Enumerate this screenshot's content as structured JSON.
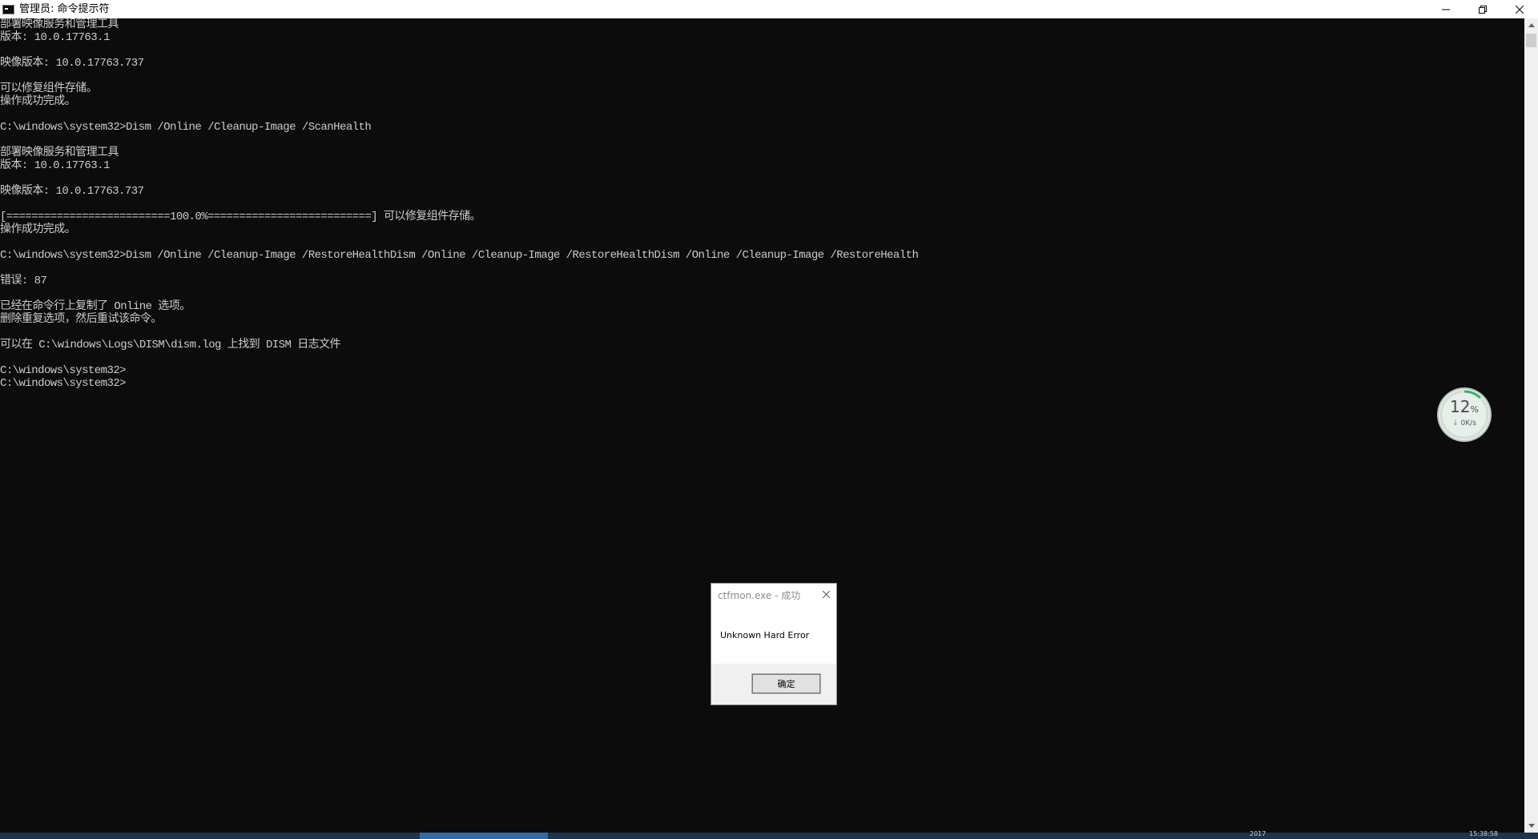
{
  "window": {
    "title": "管理员: 命令提示符",
    "icon": "cmd-icon",
    "controls": {
      "minimize": "minimize-icon",
      "restore": "restore-icon",
      "close": "close-icon"
    }
  },
  "console": {
    "lines": [
      "部署映像服务和管理工具",
      "版本: 10.0.17763.1",
      "",
      "映像版本: 10.0.17763.737",
      "",
      "可以修复组件存储。",
      "操作成功完成。",
      "",
      "C:\\windows\\system32>Dism /Online /Cleanup-Image /ScanHealth",
      "",
      "部署映像服务和管理工具",
      "版本: 10.0.17763.1",
      "",
      "映像版本: 10.0.17763.737",
      "",
      "[==========================100.0%==========================] 可以修复组件存储。",
      "操作成功完成。",
      "",
      "C:\\windows\\system32>Dism /Online /Cleanup-Image /RestoreHealthDism /Online /Cleanup-Image /RestoreHealthDism /Online /Cleanup-Image /RestoreHealth",
      "",
      "错误: 87",
      "",
      "已经在命令行上复制了 Online 选项。",
      "删除重复选项，然后重试该命令。",
      "",
      "可以在 C:\\windows\\Logs\\DISM\\dism.log 上找到 DISM 日志文件",
      "",
      "C:\\windows\\system32>",
      "C:\\windows\\system32>"
    ]
  },
  "net_widget": {
    "percent": "12",
    "percent_sign": "%",
    "percent_value": 0.12,
    "speed": "0K/s",
    "arrow": "↓",
    "ring_color": "#2fb46a"
  },
  "dialog": {
    "title": "ctfmon.exe - 成功",
    "message": "Unknown Hard Error",
    "ok_label": "确定"
  },
  "taskbar": {
    "left_text": "2017",
    "clock": "15:38:58"
  },
  "colors": {
    "console_bg": "#0c0c0c",
    "console_text": "#cccccc",
    "taskbar": "#1a3550",
    "taskbar_active": "#2f6ba6"
  }
}
